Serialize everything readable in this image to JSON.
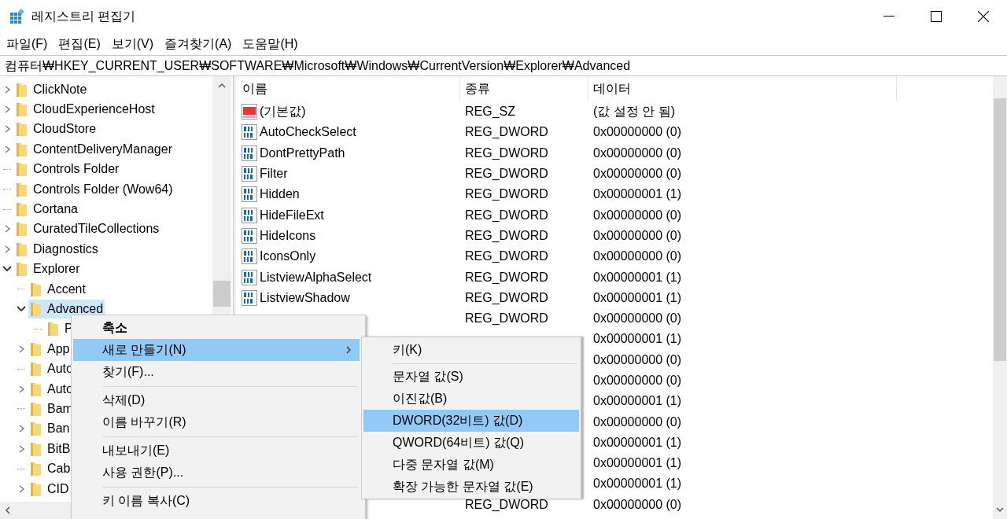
{
  "window": {
    "title": "레지스트리 편집기"
  },
  "menu_bar": [
    "파일(F)",
    "편집(E)",
    "보기(V)",
    "즐겨찾기(A)",
    "도움말(H)"
  ],
  "address_bar": {
    "value": "컴퓨터₩HKEY_CURRENT_USER₩SOFTWARE₩Microsoft₩Windows₩CurrentVersion₩Explorer₩Advanced"
  },
  "tree": {
    "items": [
      {
        "label": "ClickNote",
        "expanded": false,
        "selected": false
      },
      {
        "label": "CloudExperienceHost",
        "expanded": false,
        "selected": false
      },
      {
        "label": "CloudStore",
        "expanded": false,
        "selected": false
      },
      {
        "label": "ContentDeliveryManager",
        "expanded": false,
        "selected": false
      },
      {
        "label": "Controls Folder",
        "selected": false
      },
      {
        "label": "Controls Folder (Wow64)",
        "selected": false
      },
      {
        "label": "Cortana",
        "selected": false
      },
      {
        "label": "CuratedTileCollections",
        "expanded": false,
        "selected": false
      },
      {
        "label": "Diagnostics",
        "expanded": false,
        "selected": false
      },
      {
        "label": "Explorer",
        "expanded": true,
        "selected": false,
        "children": [
          {
            "label": "Accent",
            "selected": false
          },
          {
            "label": "Advanced",
            "expanded": true,
            "selected": true,
            "children": [
              {
                "label": "P",
                "selected": false
              }
            ]
          },
          {
            "label": "App",
            "expanded": false,
            "selected": false
          },
          {
            "label": "Auto",
            "selected": false
          },
          {
            "label": "Auto",
            "expanded": false,
            "selected": false
          },
          {
            "label": "Bam",
            "selected": false
          },
          {
            "label": "Ban",
            "expanded": false,
            "selected": false
          },
          {
            "label": "BitB",
            "expanded": false,
            "selected": false
          },
          {
            "label": "Cab",
            "selected": false
          },
          {
            "label": "CID",
            "expanded": false,
            "selected": false
          }
        ]
      }
    ]
  },
  "values_list": {
    "columns": [
      "이름",
      "종류",
      "데이터"
    ],
    "rows": [
      {
        "kind": "string",
        "name": "(기본값)",
        "type": "REG_SZ",
        "data": "(값 설정 안 됨)"
      },
      {
        "kind": "dword",
        "name": "AutoCheckSelect",
        "type": "REG_DWORD",
        "data": "0x00000000 (0)"
      },
      {
        "kind": "dword",
        "name": "DontPrettyPath",
        "type": "REG_DWORD",
        "data": "0x00000000 (0)"
      },
      {
        "kind": "dword",
        "name": "Filter",
        "type": "REG_DWORD",
        "data": "0x00000000 (0)"
      },
      {
        "kind": "dword",
        "name": "Hidden",
        "type": "REG_DWORD",
        "data": "0x00000001 (1)"
      },
      {
        "kind": "dword",
        "name": "HideFileExt",
        "type": "REG_DWORD",
        "data": "0x00000000 (0)"
      },
      {
        "kind": "dword",
        "name": "HideIcons",
        "type": "REG_DWORD",
        "data": "0x00000000 (0)"
      },
      {
        "kind": "dword",
        "name": "IconsOnly",
        "type": "REG_DWORD",
        "data": "0x00000000 (0)"
      },
      {
        "kind": "dword",
        "name": "ListviewAlphaSelect",
        "type": "REG_DWORD",
        "data": "0x00000001 (1)"
      },
      {
        "kind": "dword",
        "name": "ListviewShadow",
        "type": "REG_DWORD",
        "data": "0x00000001 (1)"
      },
      {
        "type": "REG_DWORD",
        "data": "0x00000000 (0)"
      },
      {
        "data": "0x00000001 (1)"
      },
      {
        "data": "0x00000000 (0)"
      },
      {
        "data": "0x00000000 (0)"
      },
      {
        "data": "0x00000001 (1)"
      },
      {
        "data": "0x00000000 (0)"
      },
      {
        "data": "0x00000001 (1)"
      },
      {
        "data": "0x00000001 (1)"
      },
      {
        "data": "0x00000001 (1)"
      },
      {
        "type": "REG_DWORD",
        "data": "0x00000000 (0)"
      }
    ]
  },
  "context_menu": {
    "items": [
      {
        "kind": "item",
        "label": "축소",
        "default": true,
        "has_submenu": false,
        "selected": false
      },
      {
        "kind": "item",
        "label": "새로 만들기(N)",
        "default": false,
        "has_submenu": true,
        "selected": true
      },
      {
        "kind": "item",
        "label": "찾기(F)...",
        "default": false,
        "has_submenu": false,
        "selected": false
      },
      {
        "kind": "separator"
      },
      {
        "kind": "item",
        "label": "삭제(D)",
        "default": false,
        "has_submenu": false,
        "selected": false
      },
      {
        "kind": "item",
        "label": "이름 바꾸기(R)",
        "default": false,
        "has_submenu": false,
        "selected": false
      },
      {
        "kind": "separator"
      },
      {
        "kind": "item",
        "label": "내보내기(E)",
        "default": false,
        "has_submenu": false,
        "selected": false
      },
      {
        "kind": "item",
        "label": "사용 권한(P)...",
        "default": false,
        "has_submenu": false,
        "selected": false
      },
      {
        "kind": "separator"
      },
      {
        "kind": "item",
        "label": "키 이름 복사(C)",
        "default": false,
        "has_submenu": false,
        "selected": false
      }
    ]
  },
  "submenu": {
    "items": [
      {
        "kind": "item",
        "label": "키(K)",
        "selected": false
      },
      {
        "kind": "separator"
      },
      {
        "kind": "item",
        "label": "문자열 값(S)",
        "selected": false
      },
      {
        "kind": "item",
        "label": "이진값(B)",
        "selected": false
      },
      {
        "kind": "item",
        "label": "DWORD(32비트) 값(D)",
        "selected": true
      },
      {
        "kind": "item",
        "label": "QWORD(64비트) 값(Q)",
        "selected": false
      },
      {
        "kind": "item",
        "label": "다중 문자열 값(M)",
        "selected": false
      },
      {
        "kind": "item",
        "label": "확장 가능한 문자열 값(E)",
        "selected": false
      }
    ]
  }
}
